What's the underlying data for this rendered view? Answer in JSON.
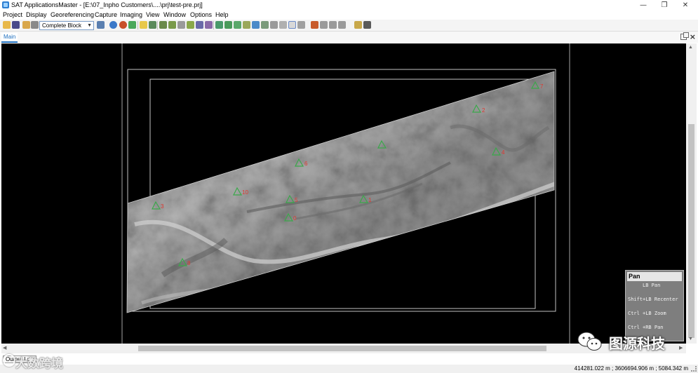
{
  "window": {
    "title": "SAT ApplicationsMaster - [E:\\07_Inpho Customers\\....\\prj\\test-pre.prj]",
    "minimize_glyph": "—",
    "maximize_glyph": "❐",
    "close_glyph": "✕"
  },
  "menu": [
    "Project",
    "Display",
    "Georeferencing",
    "Capture",
    "Imaging",
    "View",
    "Window",
    "Options",
    "Help"
  ],
  "toolbar": {
    "block_select_value": "Complete Block",
    "icons": [
      "open-folder-icon",
      "save-icon",
      "edit-icon",
      "print-icon",
      "grid-icon",
      "globe-icon",
      "color-icon",
      "layers-icon",
      "warning-icon",
      "point-icon",
      "tie-icon",
      "edit-point-icon",
      "compare-icon",
      "measure-icon",
      "stack-icon",
      "select-icon",
      "move-icon",
      "zoom-icon",
      "pan-hand-icon",
      "refresh-icon",
      "fit-icon",
      "prev-icon",
      "next-icon",
      "tools-icon"
    ]
  },
  "tabs": {
    "main_label": "Main"
  },
  "viewport": {
    "gcp_color": "#3aa84a",
    "label_color": "#e0372f",
    "points": [
      {
        "id": "7"
      },
      {
        "id": "2"
      },
      {
        "id": "4"
      },
      {
        "id": ""
      },
      {
        "id": "6"
      },
      {
        "id": "10"
      },
      {
        "id": "1"
      },
      {
        "id": "5"
      },
      {
        "id": "3"
      },
      {
        "id": "0"
      },
      {
        "id": "8"
      }
    ]
  },
  "help_panel": {
    "title": "Pan",
    "rows": [
      {
        "key": "",
        "action": "LB Pan"
      },
      {
        "key": "Shift",
        "action": "+LB Recenter"
      },
      {
        "key": "Ctrl",
        "action": "+LB Zoom"
      },
      {
        "key": "Ctrl",
        "action": "+RB Pan"
      }
    ]
  },
  "bottom": {
    "output_tab": "Output Log"
  },
  "status": {
    "coordinates": "414281.022 m ; 3606694.906 m ; 5084.342 m"
  },
  "watermarks": {
    "left": "大数跨境",
    "right": "图源科技"
  }
}
